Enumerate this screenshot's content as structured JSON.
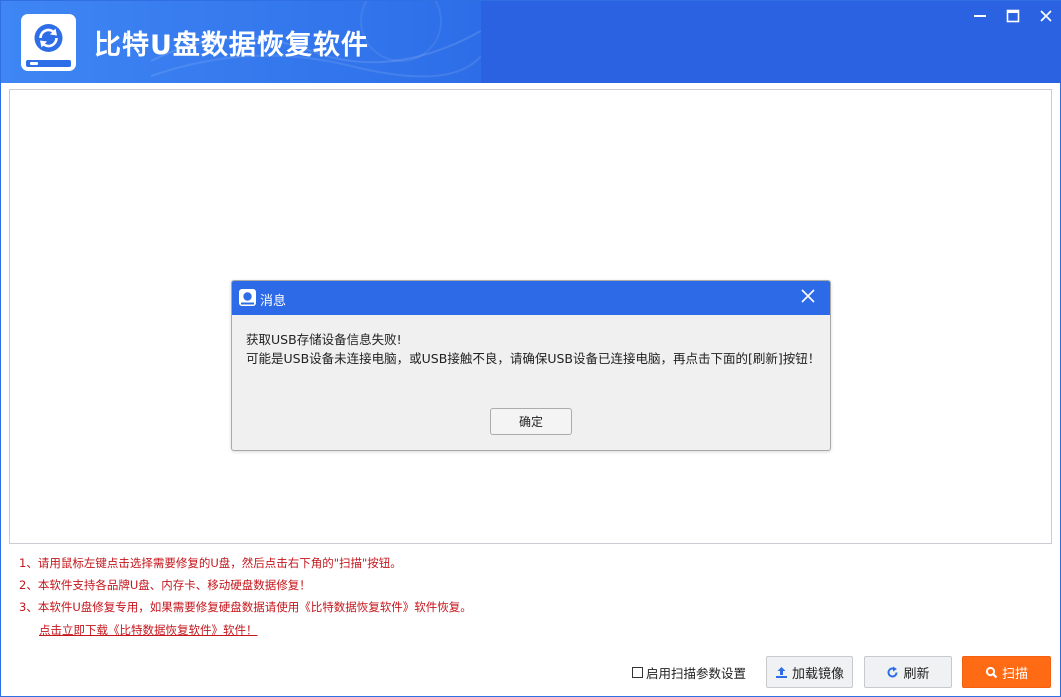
{
  "window": {
    "title": "比特U盘数据恢复软件",
    "controls": [
      "minimize-icon",
      "maximize-icon",
      "close-icon"
    ]
  },
  "instructions": [
    "1、请用鼠标左键点击选择需要修复的U盘，然后点击右下角的\"扫描\"按钮。",
    "2、本软件支持各品牌U盘、内存卡、移动硬盘数据修复！",
    "3、本软件U盘修复专用，如果需要修复硬盘数据请使用《比特数据恢复软件》软件恢复。"
  ],
  "download_link": "点击立即下载《比特数据恢复软件》软件！",
  "bottom_bar": {
    "scan_settings_label": "启用扫描参数设置",
    "scan_settings_checked": false,
    "load_image_label": "加载镜像",
    "refresh_label": "刷新",
    "scan_label": "扫描"
  },
  "dialog": {
    "title": "消息",
    "line1": "获取USB存储设备信息失败!",
    "line2": "可能是USB设备未连接电脑，或USB接触不良，请确保USB设备已连接电脑，再点击下面的[刷新]按钮！",
    "ok_label": "确定"
  },
  "colors": {
    "title_bar": "#2d6ee8",
    "scan_button": "#ff6a14",
    "instruction_text": "#c4161c"
  },
  "icons": {
    "app_logo": "disk-refresh-icon",
    "load_image": "upload-icon",
    "refresh": "refresh-icon",
    "scan": "search-icon",
    "dialog": "app-small-icon",
    "dialog_close": "close-icon"
  }
}
